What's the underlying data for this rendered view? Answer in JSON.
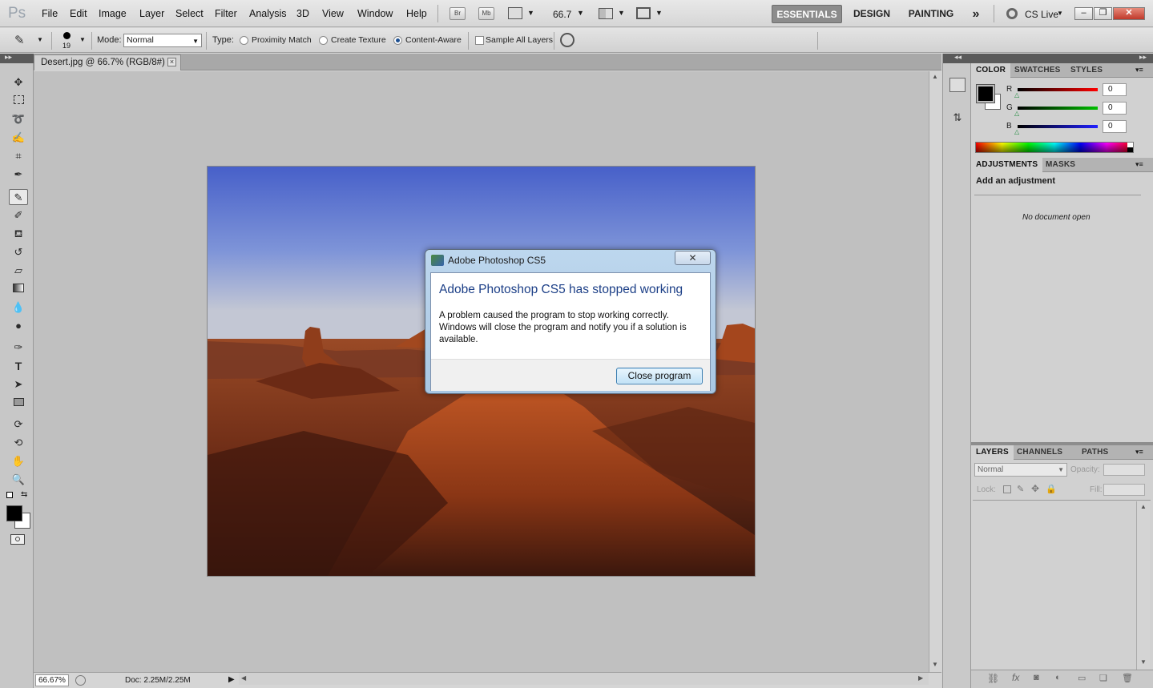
{
  "app": {
    "logo": "Ps"
  },
  "menu": [
    "File",
    "Edit",
    "Image",
    "Layer",
    "Select",
    "Filter",
    "Analysis",
    "3D",
    "View",
    "Window",
    "Help"
  ],
  "menubar": {
    "bridge": "Br",
    "minibridge": "Mb",
    "zoom": "66.7"
  },
  "workspaces": {
    "essentials": "ESSENTIALS",
    "design": "DESIGN",
    "painting": "PAINTING",
    "more": "»",
    "cslive": "CS Live"
  },
  "options": {
    "brush_size": "19",
    "mode_label": "Mode:",
    "mode_value": "Normal",
    "type_label": "Type:",
    "type_options": [
      "Proximity Match",
      "Create Texture",
      "Content-Aware"
    ],
    "type_selected": "Content-Aware",
    "sample_all_layers": "Sample All Layers"
  },
  "document": {
    "tab_title": "Desert.jpg @ 66.7% (RGB/8#)",
    "zoom_status": "66.67%",
    "doc_size": "Doc: 2.25M/2.25M"
  },
  "dialog": {
    "title": "Adobe Photoshop CS5",
    "heading": "Adobe Photoshop CS5 has stopped working",
    "message": "A problem caused the program to stop working correctly. Windows will close the program and notify you if a solution is available.",
    "button": "Close program"
  },
  "color_panel": {
    "tabs": [
      "COLOR",
      "SWATCHES",
      "STYLES"
    ],
    "channels": [
      {
        "label": "R",
        "value": "0",
        "color": "#ff0000"
      },
      {
        "label": "G",
        "value": "0",
        "color": "#00c000"
      },
      {
        "label": "B",
        "value": "0",
        "color": "#2020ff"
      }
    ]
  },
  "adjustments_panel": {
    "tabs": [
      "ADJUSTMENTS",
      "MASKS"
    ],
    "title": "Add an adjustment",
    "empty": "No document open"
  },
  "layers_panel": {
    "tabs": [
      "LAYERS",
      "CHANNELS",
      "PATHS"
    ],
    "blend": "Normal",
    "opacity_label": "Opacity:",
    "lock_label": "Lock:",
    "fill_label": "Fill:"
  },
  "colors": {
    "fg": "#000000",
    "bg": "#ffffff"
  }
}
